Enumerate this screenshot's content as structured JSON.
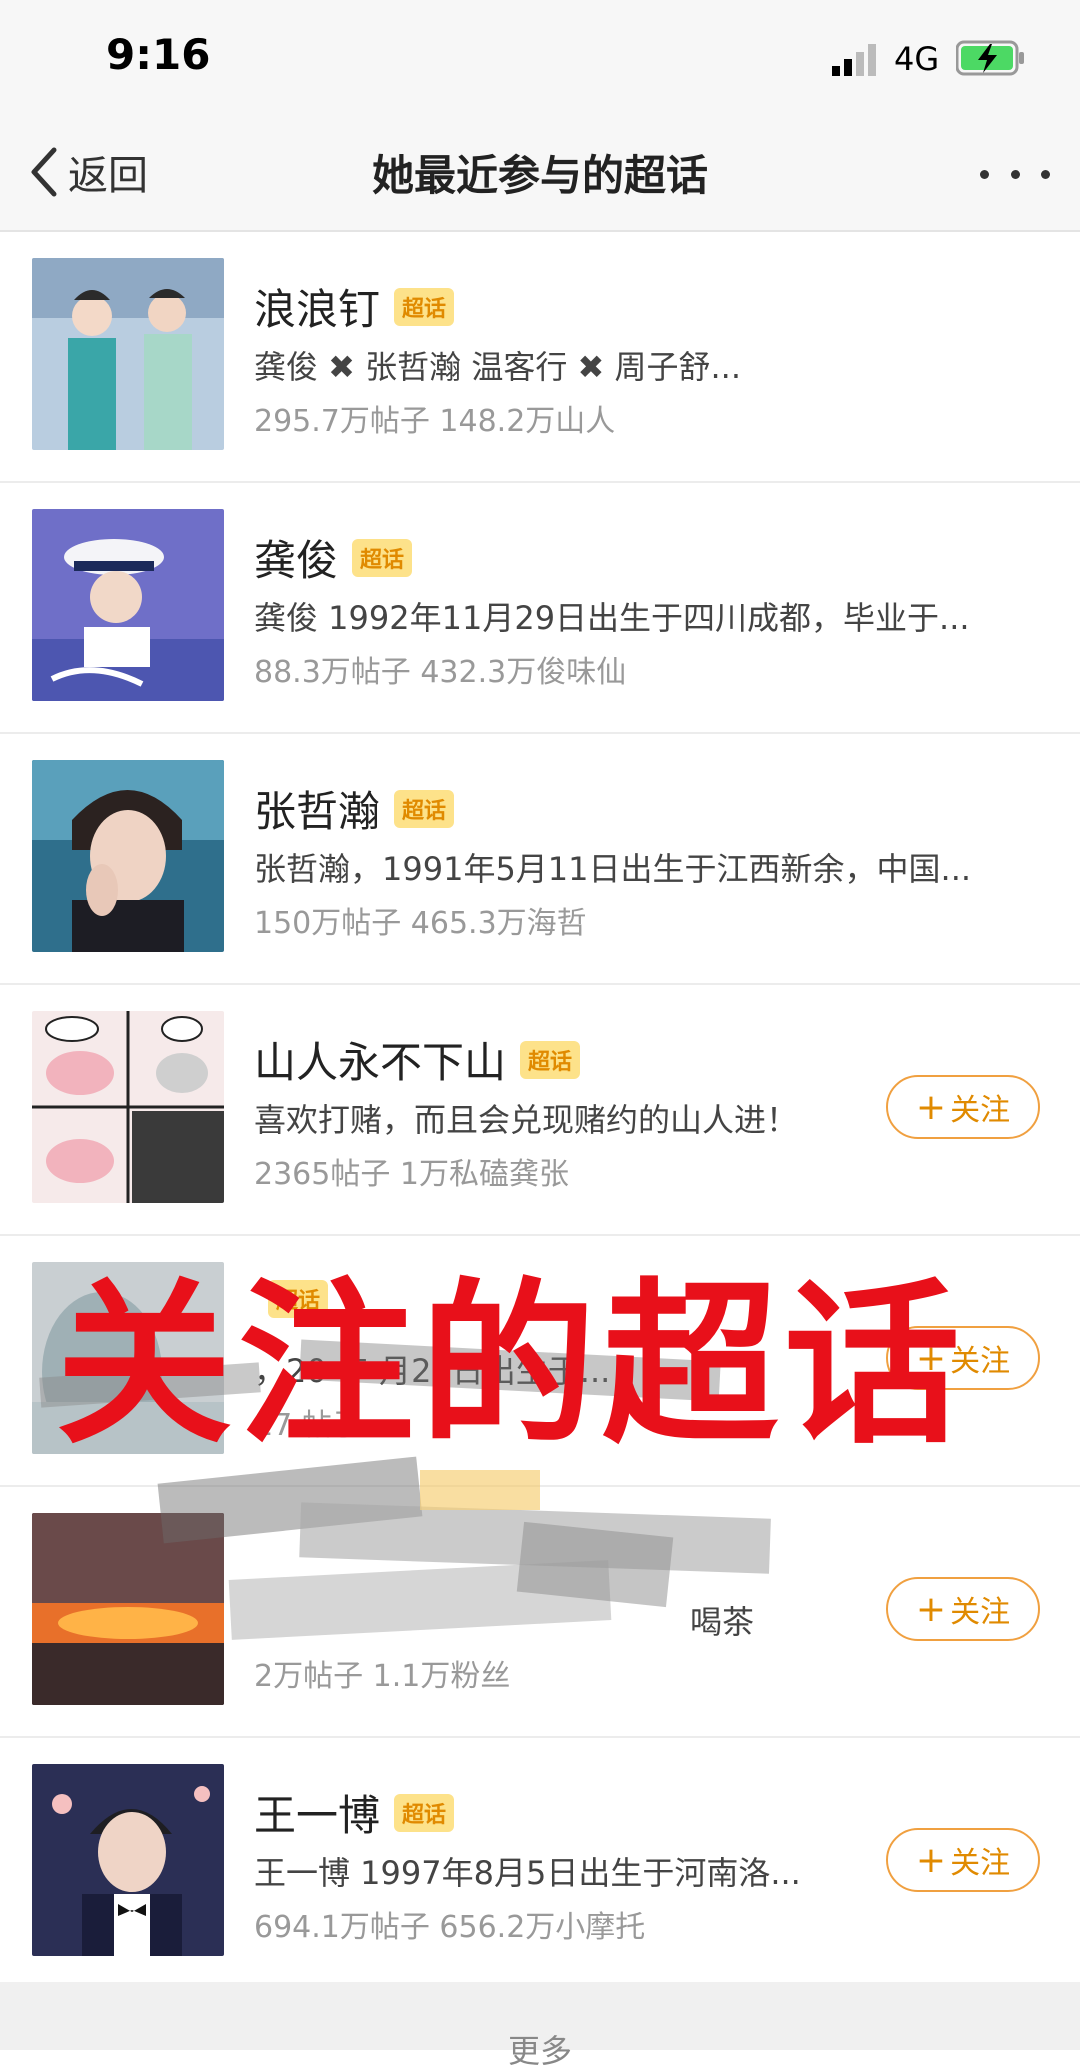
{
  "status": {
    "time": "9:16",
    "network": "4G"
  },
  "nav": {
    "back_label": "返回",
    "title": "她最近参与的超话"
  },
  "tag_label": "超话",
  "follow_label": "关注",
  "items": [
    {
      "title": "浪浪钉",
      "desc": "龚俊 ✖ 张哲瀚  温客行 ✖ 周子舒...",
      "stats": "295.7万帖子 148.2万山人",
      "follow": false
    },
    {
      "title": "龚俊",
      "desc": "龚俊 1992年11月29日出生于四川成都，毕业于...",
      "stats": "88.3万帖子 432.3万俊味仙",
      "follow": false
    },
    {
      "title": "张哲瀚",
      "desc": "张哲瀚，1991年5月11日出生于江西新余，中国...",
      "stats": "150万帖子 465.3万海哲",
      "follow": false
    },
    {
      "title": "山人永不下山",
      "desc": "喜欢打赌，而且会兑现赌约的山人进！",
      "stats": "2365帖子 1万私磕龚张",
      "follow": true
    },
    {
      "title": "",
      "desc": "，20  年  月28日出生于...",
      "stats": "17   帖子",
      "follow": true
    },
    {
      "title": "",
      "desc": "喝茶",
      "stats": "2万帖子 1.1万粉丝",
      "follow": true
    },
    {
      "title": "王一博",
      "desc": "王一博 1997年8月5日出生于河南洛...",
      "stats": "694.1万帖子 656.2万小摩托",
      "follow": true
    }
  ],
  "overlay_caption": "关注的超话",
  "footer": {
    "more_label": "更多"
  },
  "colors": {
    "accent": "#e08a00",
    "tag_bg": "#fde28a",
    "overlay_red": "#e8101a"
  }
}
